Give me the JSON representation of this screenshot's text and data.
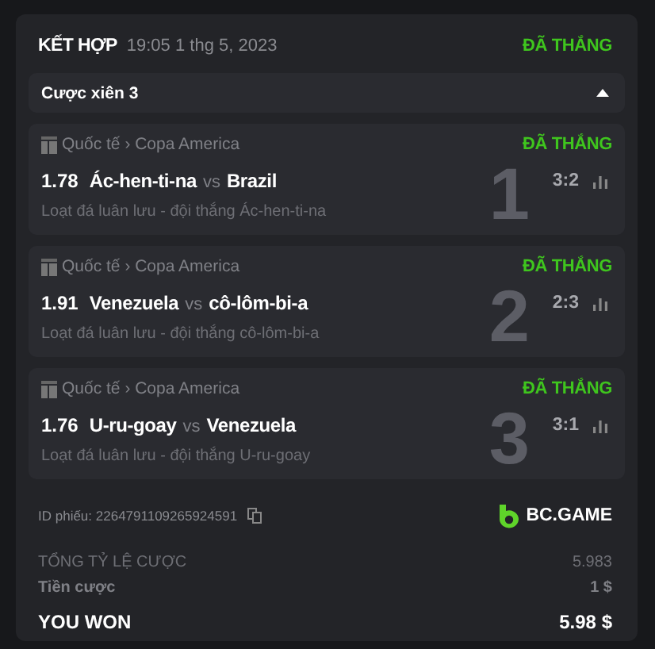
{
  "header": {
    "title": "KẾT HỢP",
    "time": "19:05 1 thg 5, 2023",
    "status": "ĐÃ THẮNG",
    "won": true
  },
  "parlay": {
    "label": "Cược xiên 3",
    "expanded": true
  },
  "legs": [
    {
      "index": "1",
      "league": "Quốc tế › Copa America",
      "status": "ĐÃ THẮNG",
      "won": true,
      "odds": "1.78",
      "home": "Ác-hen-ti-na",
      "vs": "vs",
      "away": "Brazil",
      "score": "3:2",
      "market": "Loạt đá luân lưu - đội thắng Ác-hen-ti-na"
    },
    {
      "index": "2",
      "league": "Quốc tế › Copa America",
      "status": "ĐÃ THẮNG",
      "won": true,
      "odds": "1.91",
      "home": "Venezuela",
      "vs": "vs",
      "away": "cô-lôm-bi-a",
      "score": "2:3",
      "market": "Loạt đá luân lưu - đội thắng cô-lôm-bi-a"
    },
    {
      "index": "3",
      "league": "Quốc tế › Copa America",
      "status": "ĐÃ THẮNG",
      "won": true,
      "odds": "1.76",
      "home": "U-ru-goay",
      "vs": "vs",
      "away": "Venezuela",
      "score": "3:1",
      "market": "Loạt đá luân lưu - đội thắng U-ru-goay"
    }
  ],
  "ticket": {
    "id": "ID phiếu: 2264791109265924591",
    "brand": "BC.GAME"
  },
  "totals": [
    {
      "label": "TỔNG TỶ LỆ CƯỢC",
      "value": "5.983",
      "kind": "odds"
    },
    {
      "label": "Tiền cược",
      "value": "1 $",
      "kind": "stake"
    },
    {
      "label": "YOU WON",
      "value": "5.98 $",
      "kind": "won"
    }
  ]
}
